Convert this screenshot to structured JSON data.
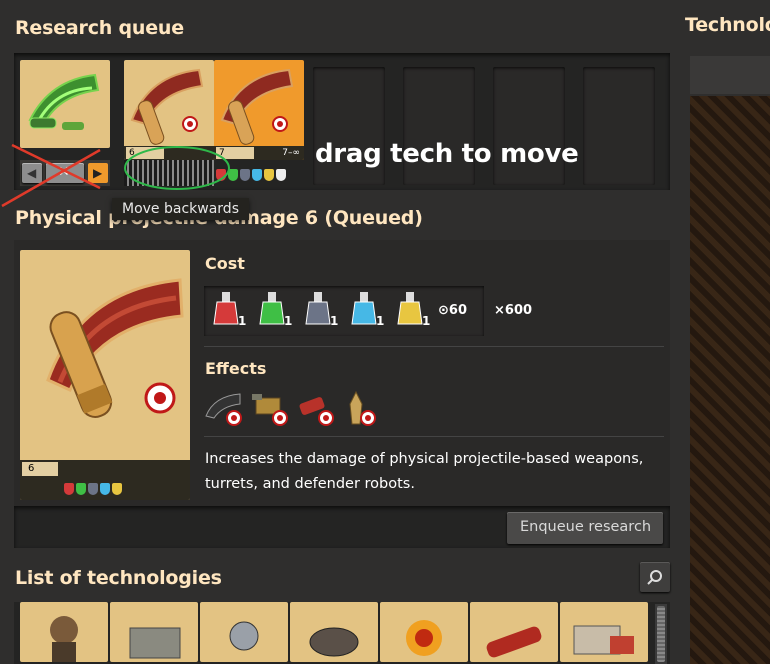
{
  "queue": {
    "title": "Research queue",
    "overlay_text": "drag tech to move",
    "tooltip": "Move backwards",
    "items": [
      {
        "level": "6",
        "level_range": ""
      },
      {
        "level": "7",
        "level_range": "7–∞"
      }
    ]
  },
  "right_title": "Technolo",
  "details": {
    "title": "Physical projectile damage 6 (Queued)",
    "level": "6",
    "cost_label": "Cost",
    "ingredients": [
      {
        "color": "#d53a3a",
        "count": "1",
        "name": "automation-science-pack-icon"
      },
      {
        "color": "#3fbf45",
        "count": "1",
        "name": "logistic-science-pack-icon"
      },
      {
        "color": "#6c7487",
        "count": "1",
        "name": "military-science-pack-icon"
      },
      {
        "color": "#46b8e6",
        "count": "1",
        "name": "chemical-science-pack-icon"
      },
      {
        "color": "#e8c640",
        "count": "1",
        "name": "utility-science-pack-icon"
      }
    ],
    "time": "60",
    "multiplier": "×600",
    "effects_label": "Effects",
    "description": "Increases the damage of physical projectile-based weapons, turrets, and defender robots.",
    "enqueue_button": "Enqueue research"
  },
  "technologies": {
    "title": "List of technologies",
    "tiles": [
      "tech-armor-icon",
      "tech-wall-icon",
      "tech-radar-icon",
      "tech-landmine-icon",
      "tech-explosives-icon",
      "tech-rocket-icon",
      "tech-building-icon"
    ]
  }
}
